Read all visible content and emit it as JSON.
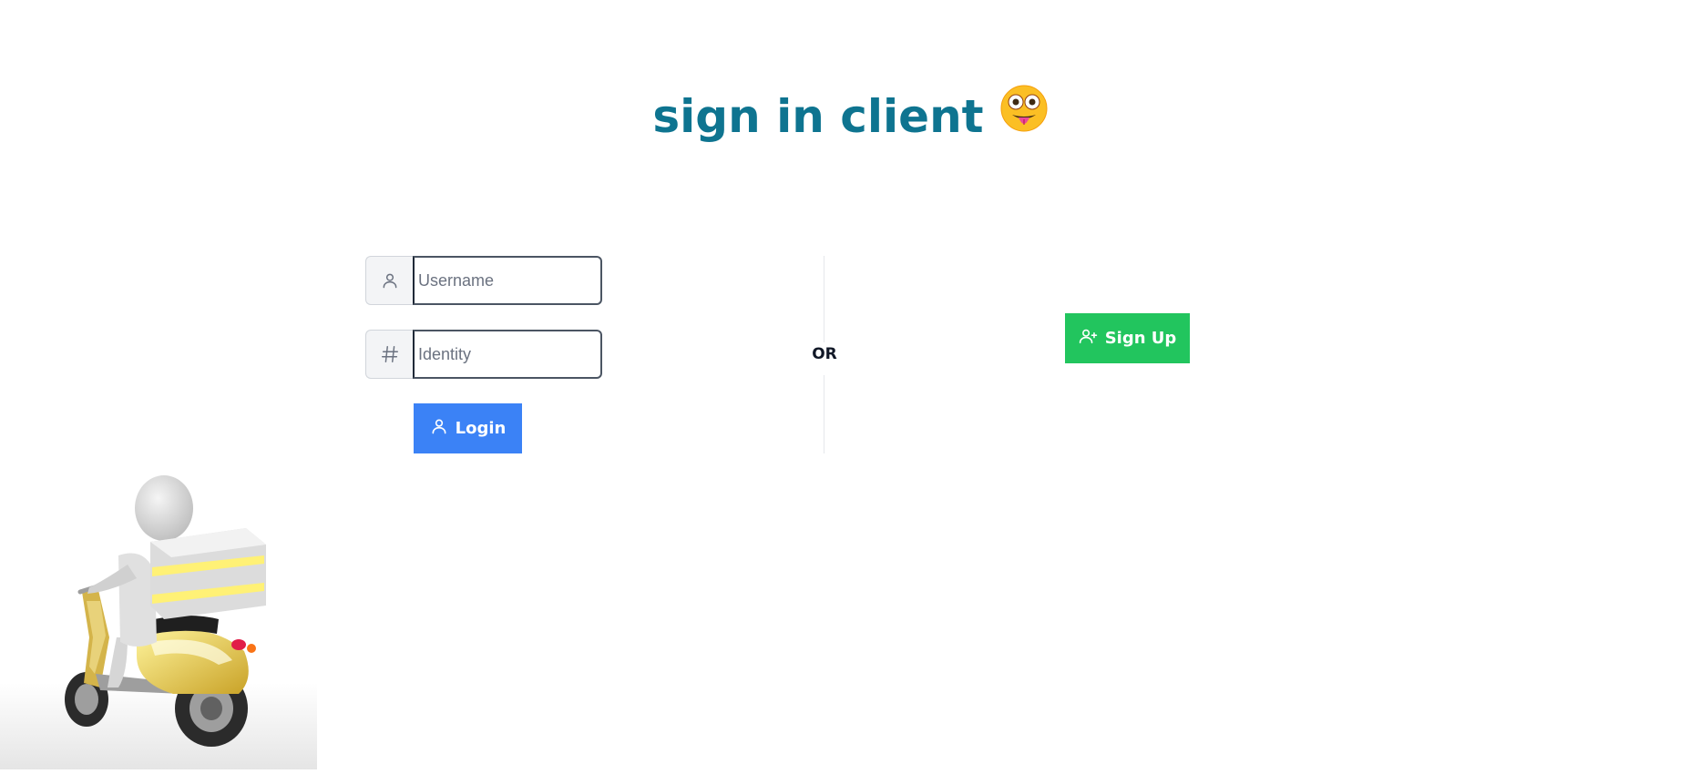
{
  "title": {
    "text": "sign in client",
    "color": "#0e7490",
    "emoji_icon": "zany-face-icon"
  },
  "login_form": {
    "username": {
      "placeholder": "Username",
      "value": "",
      "icon": "user-icon"
    },
    "identity": {
      "placeholder": "Identity",
      "value": "",
      "icon": "hash-icon"
    },
    "login_button": {
      "label": "Login",
      "icon": "user-icon",
      "color": "#3b82f6"
    }
  },
  "divider": {
    "label": "OR"
  },
  "signup": {
    "button_label": "Sign Up",
    "icon": "user-plus-icon",
    "color": "#22c55e"
  },
  "illustration": {
    "icon": "delivery-scooter-figure"
  }
}
